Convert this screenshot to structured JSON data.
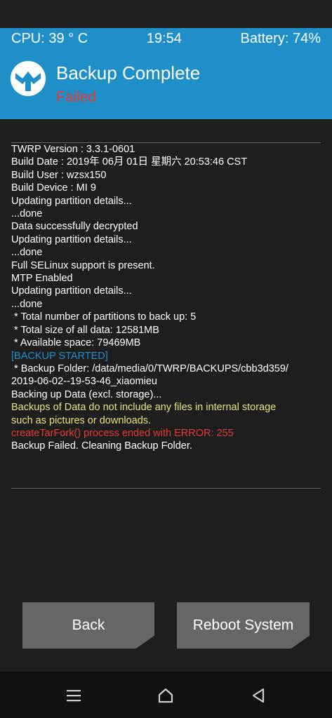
{
  "status": {
    "cpu": "CPU: 39 ° C",
    "time": "19:54",
    "battery": "Battery: 74%"
  },
  "header": {
    "title": "Backup Complete",
    "subtitle": "Failed"
  },
  "console": {
    "lines": [
      {
        "text": "TWRP Version : 3.3.1-0601",
        "color": "white"
      },
      {
        "text": "Build Date : 2019年 06月 01日 星期六 20:53:46 CST",
        "color": "white"
      },
      {
        "text": "Build User : wzsx150",
        "color": "white"
      },
      {
        "text": "Build Device : MI 9",
        "color": "white"
      },
      {
        "text": "Updating partition details...",
        "color": "white"
      },
      {
        "text": "...done",
        "color": "white"
      },
      {
        "text": "Data successfully decrypted",
        "color": "white"
      },
      {
        "text": "Updating partition details...",
        "color": "white"
      },
      {
        "text": "...done",
        "color": "white"
      },
      {
        "text": "Full SELinux support is present.",
        "color": "white"
      },
      {
        "text": "MTP Enabled",
        "color": "white"
      },
      {
        "text": "Updating partition details...",
        "color": "white"
      },
      {
        "text": "...done",
        "color": "white"
      },
      {
        "text": " * Total number of partitions to back up: 5",
        "color": "white"
      },
      {
        "text": " * Total size of all data: 12581MB",
        "color": "white"
      },
      {
        "text": " * Available space: 79469MB",
        "color": "white"
      },
      {
        "text": "[BACKUP STARTED]",
        "color": "blue"
      },
      {
        "text": " * Backup Folder: /data/media/0/TWRP/BACKUPS/cbb3d359/",
        "color": "white"
      },
      {
        "text": "2019-06-02--19-53-46_xiaomieu",
        "color": "white"
      },
      {
        "text": "Backing up Data (excl. storage)...",
        "color": "white"
      },
      {
        "text": "Backups of Data do not include any files in internal storage",
        "color": "yellow"
      },
      {
        "text": "such as pictures or downloads.",
        "color": "yellow"
      },
      {
        "text": "createTarFork() process ended with ERROR: 255",
        "color": "red"
      },
      {
        "text": "Backup Failed. Cleaning Backup Folder.",
        "color": "white"
      }
    ]
  },
  "buttons": {
    "back": "Back",
    "reboot": "Reboot System"
  },
  "nav": {
    "menu_icon": "menu-icon",
    "home_icon": "home-icon",
    "back_icon": "back-triangle-icon"
  },
  "colors": {
    "accent": "#1e8fc9",
    "background": "#1e1e1e",
    "button": "#666666",
    "error": "#e53935",
    "warning": "#e9e27a"
  }
}
